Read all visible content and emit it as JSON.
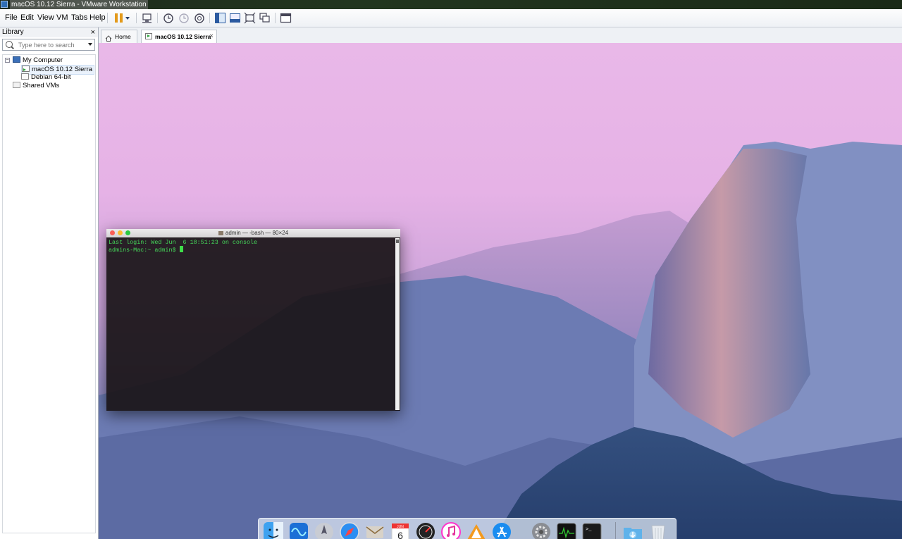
{
  "window": {
    "title": "macOS 10.12 Sierra - VMware Workstation"
  },
  "menu": [
    "File",
    "Edit",
    "View",
    "VM",
    "Tabs",
    "Help"
  ],
  "toolbar": {
    "icons": [
      "pause-icon",
      "dropdown-arrow-icon",
      "send-ctrl-alt-del-icon",
      "snapshot-take-icon",
      "snapshot-revert-icon",
      "snapshot-manager-icon",
      "library-view-icon",
      "thumbnail-view-icon",
      "fullscreen-icon",
      "unity-icon",
      "console-view-icon"
    ]
  },
  "library": {
    "title": "Library",
    "close": "×",
    "search_placeholder": "Type here to search",
    "tree": {
      "root": "My Computer",
      "children": [
        "macOS 10.12 Sierra",
        "Debian 64-bit"
      ],
      "shared": "Shared VMs"
    }
  },
  "tabs": [
    {
      "label": "Home"
    },
    {
      "label": "macOS 10.12 Sierra",
      "active": true,
      "close": "×"
    }
  ],
  "terminal": {
    "title": "admin — -bash — 80×24",
    "lines": [
      "Last login: Wed Jun  6 18:51:23 on console",
      "admins-Mac:~ admin$ "
    ]
  },
  "dock": {
    "apps": [
      "finder-icon",
      "siri-icon",
      "launchpad-icon",
      "safari-icon",
      "mail-icon",
      "calendar-icon",
      "dashboard-icon",
      "itunes-icon",
      "ibooks-icon",
      "app-store-icon",
      "system-preferences-icon",
      "activity-monitor-icon",
      "terminal-icon",
      "downloads-icon",
      "trash-icon"
    ],
    "calendar_month": "JUN",
    "calendar_day": "6",
    "terminal_prompt": ">_"
  },
  "colors": {
    "terminal_green": "#45d95a",
    "sky_top": "#e9b8e8",
    "rock": "#5d6ca8"
  }
}
